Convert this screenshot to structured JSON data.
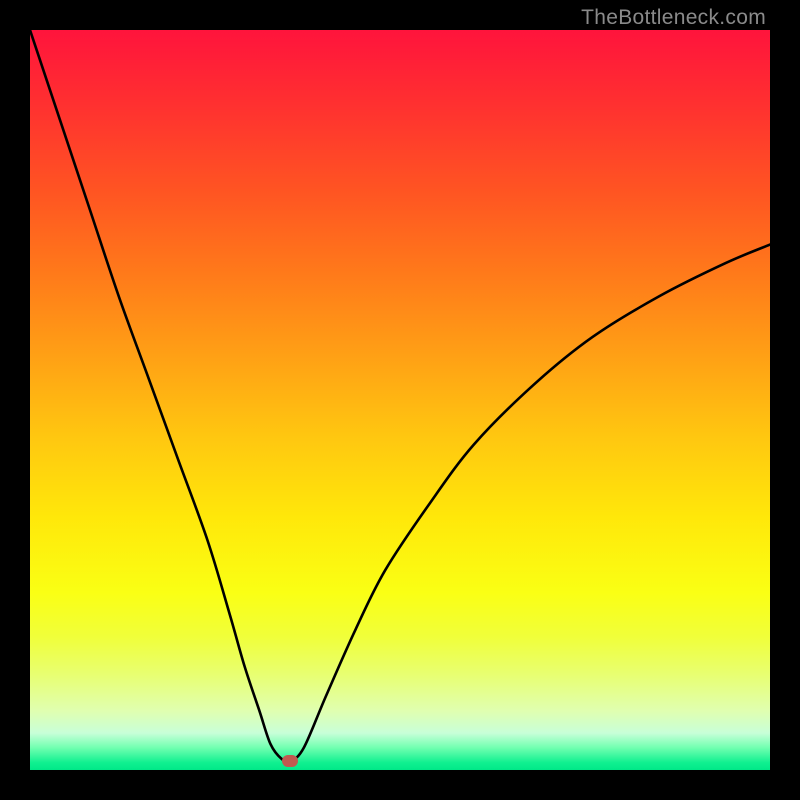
{
  "watermark": "TheBottleneck.com",
  "chart_data": {
    "type": "line",
    "title": "",
    "xlabel": "",
    "ylabel": "",
    "xlim": [
      0,
      100
    ],
    "ylim": [
      0,
      100
    ],
    "series": [
      {
        "name": "curve",
        "x": [
          0,
          4,
          8,
          12,
          16,
          20,
          24,
          27,
          29,
          31,
          32.5,
          34,
          35.2,
          37,
          40,
          44,
          48,
          54,
          60,
          68,
          76,
          85,
          94,
          100
        ],
        "y": [
          100,
          88,
          76,
          64,
          53,
          42,
          31,
          21,
          14,
          8,
          3.5,
          1.5,
          1.2,
          3,
          10,
          19,
          27,
          36,
          44,
          52,
          58.5,
          64,
          68.5,
          71
        ]
      }
    ],
    "marker": {
      "x": 35.2,
      "y": 1.2,
      "color": "#c05a50"
    },
    "background_gradient": {
      "top": "#ff143c",
      "bottom": "#00e888",
      "stops": [
        "#ff143c",
        "#ff5522",
        "#ffa015",
        "#ffe80a",
        "#e8ff70",
        "#10f090",
        "#00e888"
      ]
    }
  }
}
